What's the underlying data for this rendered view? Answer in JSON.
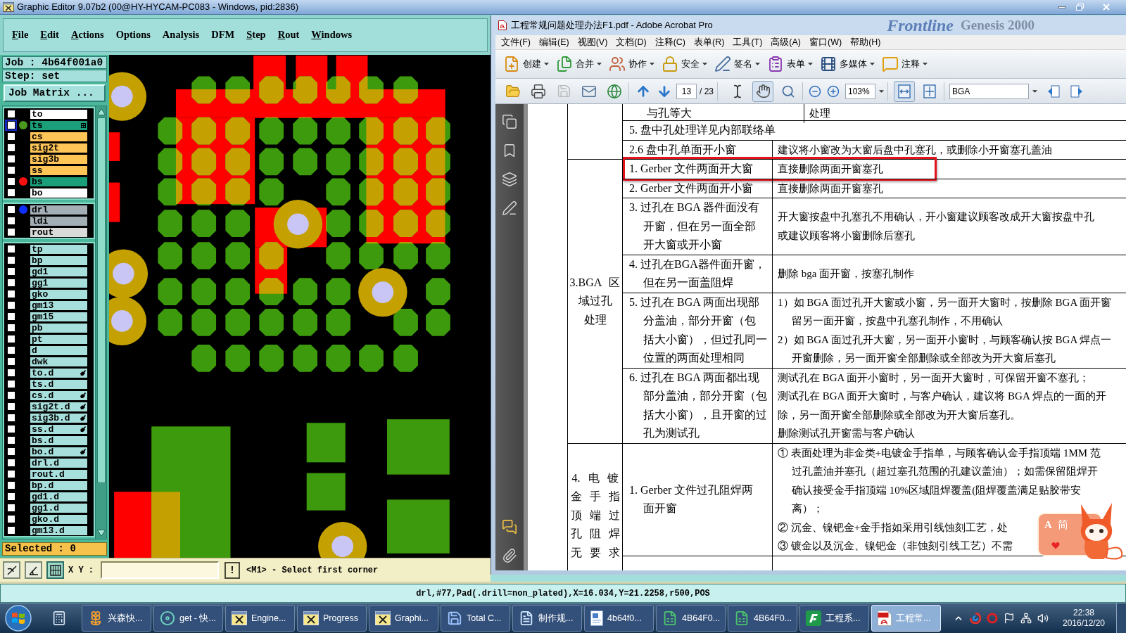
{
  "editor": {
    "title": "Graphic Editor 9.07b2 (00@HY-HYCAM-PC083 - Windows, pid:2836)",
    "menu": [
      {
        "label": "File",
        "mnemonic": true
      },
      {
        "label": "Edit",
        "mnemonic": true
      },
      {
        "label": "Actions",
        "mnemonic": true
      },
      {
        "label": "Options",
        "mnemonic": false
      },
      {
        "label": "Analysis",
        "mnemonic": false
      },
      {
        "label": "DFM",
        "mnemonic": false
      },
      {
        "label": "Step",
        "mnemonic": true
      },
      {
        "label": "Rout",
        "mnemonic": true
      },
      {
        "label": "Windows",
        "mnemonic": true
      }
    ],
    "job": "Job : 4b64f001a0",
    "step": "Step: set",
    "job_matrix": "Job Matrix ...",
    "layer_groups": [
      {
        "layers": [
          {
            "name": "to",
            "color": "#ffffff",
            "checked": false,
            "selected": false,
            "flagged": false
          },
          {
            "name": "ts",
            "color": "#1a9f7a",
            "dot": {
              "color": "#4a9a1e"
            },
            "checked": false,
            "selected": true,
            "flagged": false
          },
          {
            "name": "cs",
            "color": "#ffc557",
            "checked": false,
            "selected": false,
            "flagged": false
          },
          {
            "name": "sig2t",
            "color": "#ffc557",
            "checked": false,
            "selected": false,
            "flagged": false
          },
          {
            "name": "sig3b",
            "color": "#ffc557",
            "checked": false,
            "selected": false,
            "flagged": false
          },
          {
            "name": "ss",
            "color": "#ffc557",
            "checked": false,
            "selected": false,
            "flagged": false
          },
          {
            "name": "bs",
            "color": "#1a9f7a",
            "dot": {
              "color": "#ff1010"
            },
            "checked": false,
            "selected": false,
            "flagged": false
          },
          {
            "name": "bo",
            "color": "#ffffff",
            "checked": false,
            "selected": false,
            "flagged": false
          }
        ]
      },
      {
        "layers": [
          {
            "name": "drl",
            "color": "#a3aeb5",
            "dot": {
              "color": "#1030ff"
            },
            "checked": false,
            "selected": false,
            "flagged": false
          },
          {
            "name": "ldi",
            "color": "#a3aeb5",
            "checked": false,
            "selected": false,
            "flagged": false
          },
          {
            "name": "rout",
            "color": "#dadada",
            "checked": false,
            "selected": false,
            "flagged": false
          }
        ]
      },
      {
        "layers": [
          {
            "name": "tp",
            "color": "#a6dfdb",
            "checked": false,
            "selected": false,
            "flagged": false
          },
          {
            "name": "bp",
            "color": "#a6dfdb",
            "checked": false,
            "selected": false,
            "flagged": false
          },
          {
            "name": "gd1",
            "color": "#a6dfdb",
            "checked": false,
            "selected": false,
            "flagged": false
          },
          {
            "name": "gg1",
            "color": "#a6dfdb",
            "checked": false,
            "selected": false,
            "flagged": false
          },
          {
            "name": "gko",
            "color": "#a6dfdb",
            "checked": false,
            "selected": false,
            "flagged": false
          },
          {
            "name": "gm13",
            "color": "#a6dfdb",
            "checked": false,
            "selected": false,
            "flagged": false
          },
          {
            "name": "gm15",
            "color": "#a6dfdb",
            "checked": false,
            "selected": false,
            "flagged": false
          },
          {
            "name": "pb",
            "color": "#a6dfdb",
            "checked": false,
            "selected": false,
            "flagged": false
          },
          {
            "name": "pt",
            "color": "#a6dfdb",
            "checked": false,
            "selected": false,
            "flagged": false
          },
          {
            "name": "d",
            "color": "#a6dfdb",
            "checked": false,
            "selected": false,
            "flagged": false
          },
          {
            "name": "dwk",
            "color": "#a6dfdb",
            "checked": false,
            "selected": false,
            "flagged": false
          },
          {
            "name": "to.d",
            "color": "#a6dfdb",
            "checked": false,
            "selected": false,
            "flagged": true
          },
          {
            "name": "ts.d",
            "color": "#a6dfdb",
            "checked": false,
            "selected": false,
            "flagged": false
          },
          {
            "name": "cs.d",
            "color": "#a6dfdb",
            "checked": false,
            "selected": false,
            "flagged": true
          },
          {
            "name": "sig2t.d",
            "color": "#a6dfdb",
            "checked": false,
            "selected": false,
            "flagged": true
          },
          {
            "name": "sig3b.d",
            "color": "#a6dfdb",
            "checked": false,
            "selected": false,
            "flagged": true
          },
          {
            "name": "ss.d",
            "color": "#a6dfdb",
            "checked": false,
            "selected": false,
            "flagged": true
          },
          {
            "name": "bs.d",
            "color": "#a6dfdb",
            "checked": false,
            "selected": false,
            "flagged": false
          },
          {
            "name": "bo.d",
            "color": "#a6dfdb",
            "checked": false,
            "selected": false,
            "flagged": true
          },
          {
            "name": "drl.d",
            "color": "#a6dfdb",
            "checked": false,
            "selected": false,
            "flagged": false
          },
          {
            "name": "rout.d",
            "color": "#a6dfdb",
            "checked": false,
            "selected": false,
            "flagged": false
          },
          {
            "name": "bp.d",
            "color": "#a6dfdb",
            "checked": false,
            "selected": false,
            "flagged": false
          },
          {
            "name": "gd1.d",
            "color": "#a6dfdb",
            "checked": false,
            "selected": false,
            "flagged": false
          },
          {
            "name": "gg1.d",
            "color": "#a6dfdb",
            "checked": false,
            "selected": false,
            "flagged": false
          },
          {
            "name": "gko.d",
            "color": "#a6dfdb",
            "checked": false,
            "selected": false,
            "flagged": false
          },
          {
            "name": "gm13.d",
            "color": "#a6dfdb",
            "checked": false,
            "selected": false,
            "flagged": false
          }
        ]
      }
    ],
    "selected_count": "Selected : 0",
    "tool_buttons": [
      {
        "kind": "arc",
        "selected": false
      },
      {
        "kind": "angle",
        "selected": false
      },
      {
        "kind": "grid",
        "selected": true
      }
    ],
    "coord_label": "X Y :",
    "alert": "!",
    "prompt": "<M1> - Select first corner",
    "status": "drl,#77,Pad(.drill=non_plated),X=16.034,Y=21.2258,r500,POS"
  },
  "acrobat": {
    "title": "工程常规问题处理办法F1.pdf - Adobe Acrobat Pro",
    "title_backdrop": [
      "Frontline",
      "Genesis 2000"
    ],
    "menu": [
      "文件(F)",
      "编辑(E)",
      "视图(V)",
      "文档(D)",
      "注释(C)",
      "表单(R)",
      "工具(T)",
      "高级(A)",
      "窗口(W)",
      "帮助(H)"
    ],
    "tasks": [
      {
        "label": "创建",
        "kind": "create"
      },
      {
        "label": "合并",
        "kind": "merge"
      },
      {
        "label": "协作",
        "kind": "collaborate"
      },
      {
        "label": "安全",
        "kind": "secure"
      },
      {
        "label": "签名",
        "kind": "sign"
      },
      {
        "label": "表单",
        "kind": "forms"
      },
      {
        "label": "多媒体",
        "kind": "multimedia"
      },
      {
        "label": "注释",
        "kind": "comment"
      }
    ],
    "tools": {
      "save": {
        "disabled": true
      },
      "select": {
        "selected": false
      },
      "hand": {
        "selected": true
      },
      "marquee": {
        "selected": false
      },
      "fit_width": {
        "selected": true
      },
      "fit_page": {
        "selected": false
      }
    },
    "page": {
      "current": "13",
      "total": "/ 23"
    },
    "zoom": "103%",
    "search": "BGA",
    "document": {
      "sections": [
        {
          "rows": [
            {
              "kind": "wide",
              "cells": [
                {
                  "paragraphs": [
                    {
                      "lines": [
                        "与孔等大"
                      ]
                    }
                  ]
                },
                {
                  "paragraphs": [
                    {
                      "lines": [
                        "处理"
                      ]
                    }
                  ]
                }
              ]
            },
            {
              "kind": "span",
              "cells": [
                {
                  "paragraphs": [
                    {
                      "lines": [
                        "5. 盘中孔处理详见内部联络单"
                      ]
                    }
                  ]
                }
              ]
            },
            {
              "kind": "split",
              "cells": [
                {
                  "paragraphs": [
                    {
                      "lines": [
                        "2.6 盘中孔单面开小窗"
                      ]
                    }
                  ]
                },
                {
                  "paragraphs": [
                    {
                      "lines": [
                        "建议将小窗改为大窗后盘中孔塞孔，或删除小开窗塞孔盖油"
                      ]
                    }
                  ]
                }
              ]
            }
          ]
        },
        {
          "label": [
            "3.BGA 区",
            "域过孔",
            "处理"
          ],
          "rows": [
            {
              "kind": "split",
              "highlighted": true,
              "cells": [
                {
                  "paragraphs": [
                    {
                      "lines": [
                        "1. Gerber 文件两面开大窗"
                      ]
                    }
                  ]
                },
                {
                  "paragraphs": [
                    {
                      "lines": [
                        "直接删除两面开窗塞孔"
                      ]
                    }
                  ]
                }
              ]
            },
            {
              "kind": "split",
              "highlighted": false,
              "cells": [
                {
                  "paragraphs": [
                    {
                      "lines": [
                        "2. Gerber 文件两面开小窗"
                      ]
                    }
                  ]
                },
                {
                  "paragraphs": [
                    {
                      "lines": [
                        "直接删除两面开窗塞孔"
                      ]
                    }
                  ]
                }
              ]
            },
            {
              "kind": "split",
              "highlighted": false,
              "cells": [
                {
                  "paragraphs": [
                    {
                      "lines": [
                        "3. 过孔在 BGA 器件面没有",
                        "开窗，但在另一面全部",
                        "开大窗或开小窗"
                      ],
                      "hanging": true
                    }
                  ]
                },
                {
                  "paragraphs": [
                    {
                      "lines": [
                        "开大窗按盘中孔塞孔不用确认，开小窗建议顾客改成开大窗按盘中孔",
                        "或建议顾客将小窗删除后塞孔"
                      ]
                    }
                  ]
                }
              ]
            },
            {
              "kind": "split",
              "highlighted": false,
              "cells": [
                {
                  "paragraphs": [
                    {
                      "lines": [
                        "4. 过孔在BGA器件面开窗，",
                        "但在另一面盖阻焊"
                      ],
                      "hanging": true
                    }
                  ]
                },
                {
                  "paragraphs": [
                    {
                      "lines": [
                        "删除 bga 面开窗，按塞孔制作"
                      ]
                    }
                  ]
                }
              ]
            },
            {
              "kind": "split",
              "highlighted": false,
              "cells": [
                {
                  "paragraphs": [
                    {
                      "lines": [
                        "5. 过孔在 BGA 两面出现部",
                        "分盖油，部分开窗（包",
                        "括大小窗），但过孔同一",
                        "位置的两面处理相同"
                      ],
                      "hanging": true
                    }
                  ]
                },
                {
                  "paragraphs": [
                    {
                      "lines": [
                        "1）如 BGA 面过孔开大窗或小窗，另一面开大窗时，按删除 BGA 面开窗",
                        "留另一面开窗，按盘中孔塞孔制作，不用确认"
                      ],
                      "hanging": true
                    },
                    {
                      "lines": [
                        "2）如 BGA 面过孔开大窗，另一面开小窗时，与顾客确认按 BGA 焊点一",
                        "开窗删除，另一面开窗全部删除或全部改为开大窗后塞孔"
                      ],
                      "hanging": true
                    }
                  ]
                }
              ]
            },
            {
              "kind": "split",
              "highlighted": false,
              "cells": [
                {
                  "paragraphs": [
                    {
                      "lines": [
                        "6. 过孔在 BGA 两面都出现",
                        "部分盖油，部分开窗（包",
                        "括大小窗），且开窗的过",
                        "孔为测试孔"
                      ],
                      "hanging": true
                    }
                  ]
                },
                {
                  "paragraphs": [
                    {
                      "lines": [
                        "测试孔在 BGA 面开小窗时，另一面开大窗时，可保留开窗不塞孔；"
                      ]
                    },
                    {
                      "lines": [
                        "测试孔在 BGA 面开大窗时，与客户确认，建议将 BGA 焊点的一面的开",
                        "除，另一面开窗全部删除或全部改为开大窗后塞孔。"
                      ]
                    },
                    {
                      "lines": [
                        "删除测试孔开窗需与客户确认"
                      ]
                    }
                  ]
                }
              ]
            }
          ]
        },
        {
          "label": [
            "4. 电 镀",
            "金 手 指",
            "顶 端 过",
            "孔 阻 焊",
            "无 要 求"
          ],
          "rows": [
            {
              "kind": "split",
              "highlighted": false,
              "cells": [
                {
                  "paragraphs": [
                    {
                      "lines": [
                        "1. Gerber 文件过孔阻焊两",
                        "面开窗"
                      ],
                      "hanging": true
                    }
                  ]
                },
                {
                  "paragraphs": [
                    {
                      "lines": [
                        "① 表面处理为非金类+电镀金手指单，与顾客确认金手指顶端 1MM 范",
                        "过孔盖油并塞孔（超过塞孔范围的孔建议盖油）；如需保留阻焊开",
                        "确认接受金手指顶端 10%区域阻焊覆盖(阻焊覆盖满足贴胶带安",
                        "离）；"
                      ],
                      "hanging": true
                    },
                    {
                      "lines": [
                        "② 沉金、镍钯金+金手指如采用引线蚀刻工艺，处"
                      ]
                    },
                    {
                      "lines": [
                        "③ 镀金以及沉金、镍钯金（非蚀刻引线工艺）不需"
                      ]
                    }
                  ]
                }
              ]
            }
          ]
        }
      ]
    }
  },
  "ime_widget": {
    "mode": "A",
    "script": "简"
  },
  "taskbar": {
    "items": [
      {
        "label": "兴森快...",
        "kind": "shell",
        "selected": false
      },
      {
        "label": "get - 快...",
        "kind": "disc",
        "selected": false
      },
      {
        "label": "Engine...",
        "kind": "xwindow",
        "selected": false
      },
      {
        "label": "Progress",
        "kind": "xwindow",
        "selected": false
      },
      {
        "label": "Graphi...",
        "kind": "xwindow",
        "selected": false
      },
      {
        "label": "Total C...",
        "kind": "floppy",
        "selected": false
      },
      {
        "label": "制作规...",
        "kind": "notes",
        "selected": false
      },
      {
        "label": "4b64f0...",
        "kind": "letter",
        "selected": false
      },
      {
        "label": "4B64F0...",
        "kind": "sheet",
        "selected": false
      },
      {
        "label": "4B64F0...",
        "kind": "sheet",
        "selected": false
      },
      {
        "label": "工程系...",
        "kind": "flogo",
        "selected": false
      },
      {
        "label": "工程常...",
        "kind": "pdf",
        "selected": true
      }
    ],
    "clock": {
      "time": "22:38",
      "date": "2016/12/20"
    }
  }
}
